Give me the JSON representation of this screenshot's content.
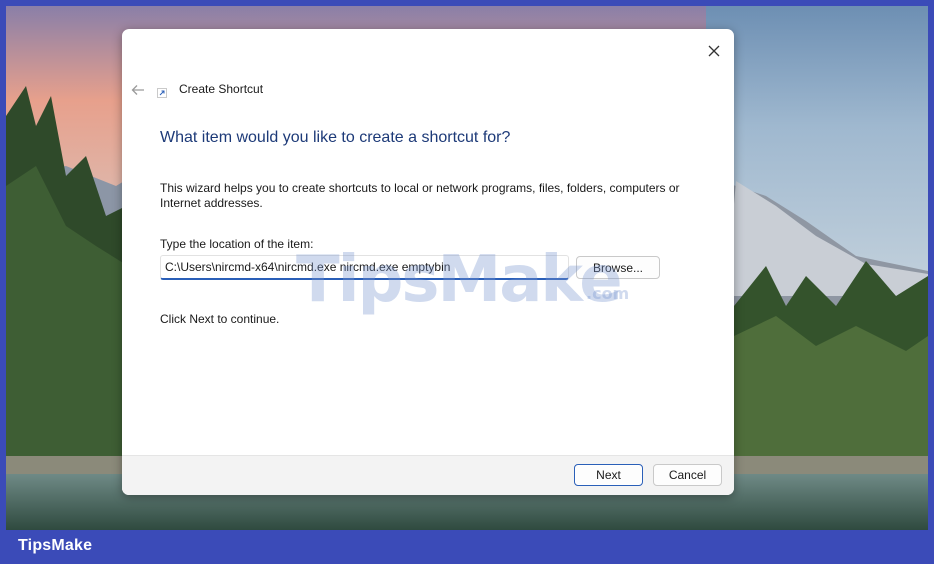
{
  "dialog": {
    "title": "Create Shortcut",
    "heading": "What item would you like to create a shortcut for?",
    "description": "This wizard helps you to create shortcuts to local or network programs, files, folders, computers or Internet addresses.",
    "field_label": "Type the location of the item:",
    "location_value": "C:\\Users\\nircmd-x64\\nircmd.exe nircmd.exe emptybin",
    "browse_label": "Browse...",
    "continue_text": "Click Next to continue.",
    "next_label": "Next",
    "cancel_label": "Cancel",
    "icons": {
      "close": "close-icon",
      "back": "back-arrow-icon",
      "wizard": "shortcut-icon"
    }
  },
  "watermark": {
    "main": "TipsMake",
    "domain": ".com"
  },
  "brand": {
    "label": "TipsMake"
  },
  "colors": {
    "frame": "#3b4bb8",
    "heading": "#1d3a78",
    "accent": "#2a5fb8"
  }
}
